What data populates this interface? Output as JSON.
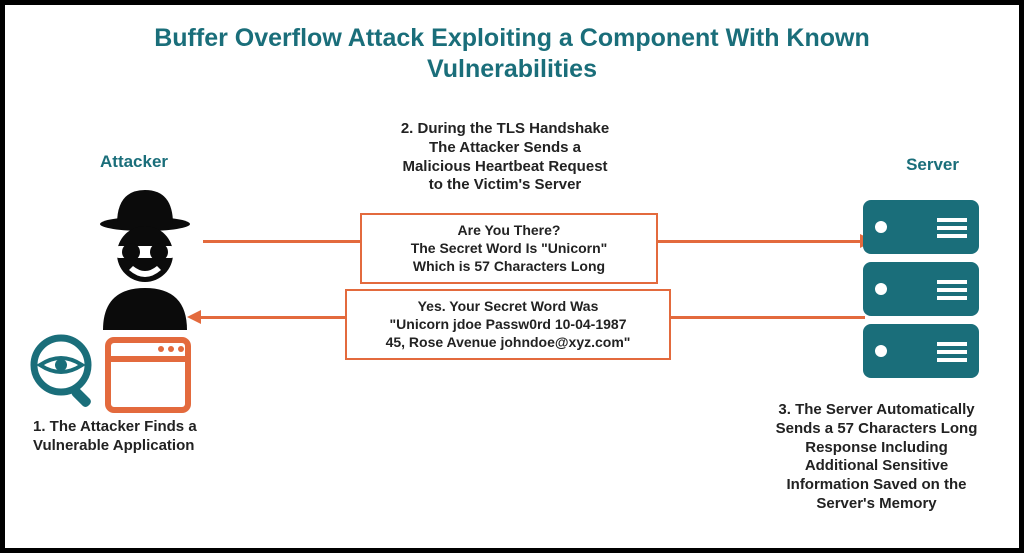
{
  "title_l1": "Buffer Overflow Attack Exploiting a Component With Known",
  "title_l2": "Vulnerabilities",
  "attacker_label": "Attacker",
  "server_label": "Server",
  "step1_l1": "1. The Attacker Finds a",
  "step1_l2": "Vulnerable Application",
  "step2_l1": "2. During the TLS Handshake",
  "step2_l2": "The Attacker Sends a",
  "step2_l3": "Malicious Heartbeat Request",
  "step2_l4": "to the Victim's Server",
  "msg_q_l1": "Are You There?",
  "msg_q_l2": "The Secret Word Is \"Unicorn\"",
  "msg_q_l3": "Which is 57 Characters Long",
  "msg_a_l1": "Yes. Your Secret Word Was",
  "msg_a_l2": "\"Unicorn jdoe Passw0rd 10-04-1987",
  "msg_a_l3": "45, Rose Avenue johndoe@xyz.com\"",
  "step3_l1": "3. The Server Automatically",
  "step3_l2": "Sends a 57 Characters Long",
  "step3_l3": "Response Including",
  "step3_l4": "Additional Sensitive",
  "step3_l5": "Information Saved on the",
  "step3_l6": "Server's Memory",
  "colors": {
    "teal": "#1a6e7a",
    "orange": "#e36a3d"
  }
}
